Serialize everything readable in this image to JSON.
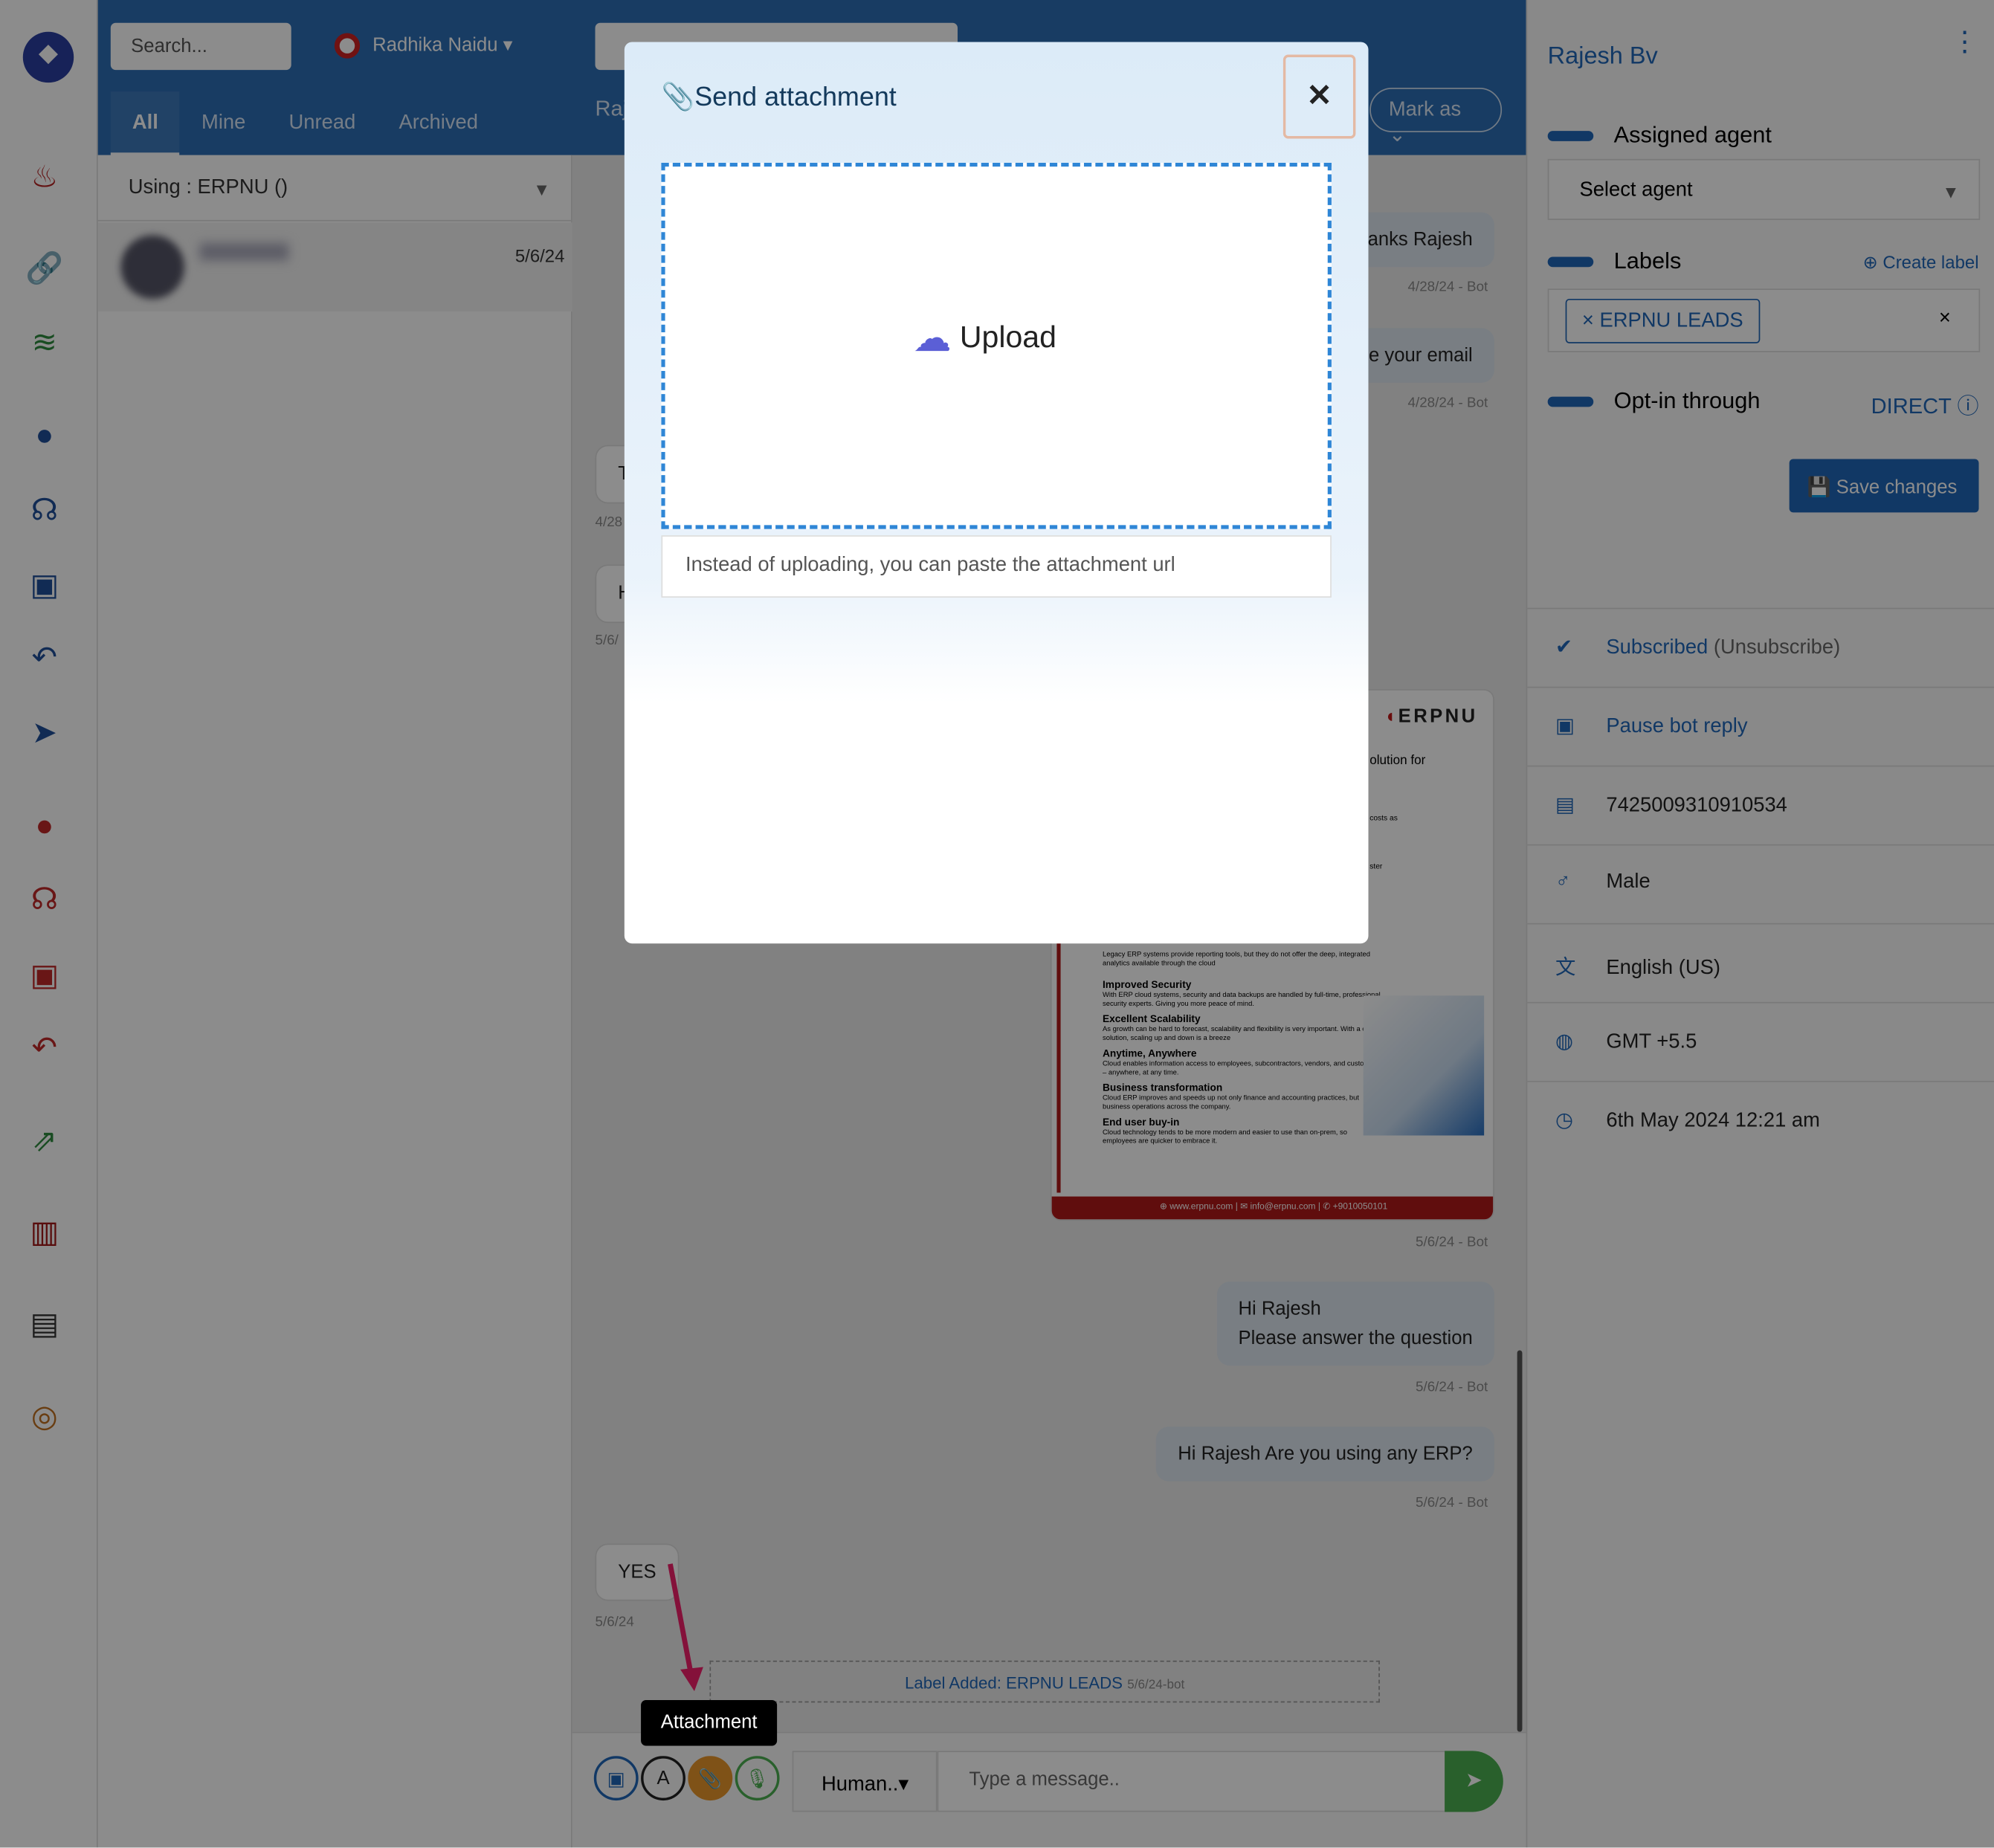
{
  "sidebar": {
    "icons": [
      "logo",
      "fire-icon",
      "link-icon",
      "wifi-icon",
      "user-circle-icon",
      "headset-icon",
      "robot-icon",
      "reply-all-icon",
      "paper-plane-icon",
      "user-circle-red-icon",
      "headset-red-icon",
      "robot-red-icon",
      "reply-all-red-icon",
      "share-icon",
      "store-icon",
      "id-card-icon",
      "coins-icon"
    ]
  },
  "header": {
    "search_placeholder": "Search...",
    "agent_name": "Radhika Naidu",
    "tabs": [
      "All",
      "Mine",
      "Unread",
      "Archived"
    ],
    "active_tab": "All",
    "contact_short": "Raj",
    "mark_as": "Mark as"
  },
  "list": {
    "using": "Using : ERPNU ()",
    "items": [
      {
        "date": "5/6/24"
      }
    ]
  },
  "chat": {
    "messages": [
      {
        "text": "anks Rajesh",
        "meta": "4/28/24 - Bot"
      },
      {
        "text": "e your email",
        "meta": "4/28/24 - Bot"
      },
      {
        "text": "T",
        "meta": "4/28"
      },
      {
        "text": "H",
        "meta": "5/6/"
      },
      {
        "text": "Hi Rajesh\nPlease answer the question",
        "meta": "5/6/24 - Bot"
      },
      {
        "text": "Hi Rajesh Are you using any ERP?",
        "meta": "5/6/24 - Bot"
      },
      {
        "text": "YES",
        "meta": "5/6/24"
      }
    ],
    "image_card": {
      "brand": "ERPNU",
      "fragments": [
        "olution for",
        "costs as",
        "ster"
      ],
      "items": [
        {
          "title": "Improved Security",
          "body": "With ERP cloud systems, security and data backups are handled by full-time, professional security experts. Giving you more peace of mind."
        },
        {
          "title": "Excellent Scalability",
          "body": "As growth can be hard to forecast, scalability and flexibility is very important. With a cloud solution, scaling up and down is a breeze"
        },
        {
          "title": "Anytime, Anywhere",
          "body": "Cloud enables information access to employees, subcontractors, vendors, and customers – anywhere, at any time."
        },
        {
          "title": "Business transformation",
          "body": "Cloud ERP improves and speeds up not only finance and accounting practices, but business operations across the company."
        },
        {
          "title": "End user buy-in",
          "body": "Cloud technology tends to be more modern and easier to use than on-prem, so employees are quicker to embrace it."
        }
      ],
      "insights_body": "Legacy ERP systems provide reporting tools, but they do not offer the deep, integrated analytics available through the cloud",
      "footer": "⊕ www.erpnu.com  |  ✉ info@erpnu.com  |  ✆ +9010050101",
      "meta": "5/6/24 - Bot"
    },
    "label_event": "Label Added: ERPNU LEADS",
    "label_event_meta": "5/6/24-bot",
    "tooltip": "Attachment",
    "mode": "Human..",
    "message_placeholder": "Type a message.."
  },
  "right": {
    "contact": "Rajesh Bv",
    "assigned_agent": "Assigned agent",
    "select_agent": "Select agent",
    "labels": "Labels",
    "create_label": "Create label",
    "label_tag": "ERPNU LEADS",
    "optin": "Opt-in through",
    "optin_value": "DIRECT",
    "save": "Save changes",
    "subscribed": "Subscribed",
    "unsubscribe": "(Unsubscribe)",
    "pause_bot": "Pause bot reply",
    "id": "7425009310910534",
    "gender": "Male",
    "language": "English (US)",
    "timezone": "GMT +5.5",
    "created": "6th May 2024 12:21 am"
  },
  "modal": {
    "title": "Send attachment",
    "upload": "Upload",
    "url_placeholder": "Instead of uploading, you can paste the attachment url"
  },
  "colors": {
    "primary": "#2d6db5",
    "accent": "#1f66b8",
    "attach": "#e8952a",
    "send": "#4caf50",
    "arrow": "#f0206a"
  }
}
